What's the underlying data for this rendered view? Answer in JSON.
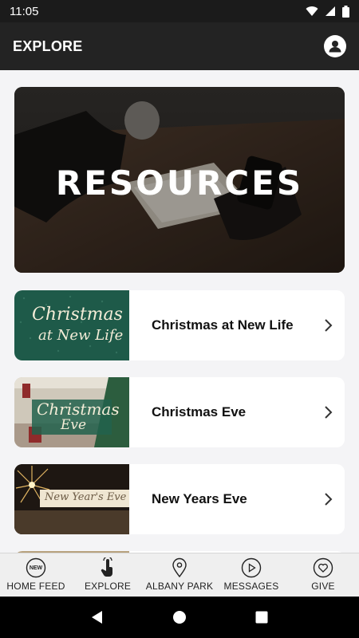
{
  "status_bar": {
    "time": "11:05"
  },
  "app_bar": {
    "title": "EXPLORE"
  },
  "hero": {
    "label": "RESOURCES"
  },
  "resources": [
    {
      "title": "Christmas at New Life",
      "thumb_line1": "Christmas",
      "thumb_line2": "at New Life"
    },
    {
      "title": "Christmas Eve",
      "thumb_line1": "Christmas",
      "thumb_line2": "Eve"
    },
    {
      "title": "New Years Eve",
      "thumb_line1": "New Year's Eve"
    }
  ],
  "bottom_nav": [
    {
      "label": "HOME FEED",
      "icon": "new-badge-icon",
      "badge": "NEW"
    },
    {
      "label": "EXPLORE",
      "icon": "touch-icon"
    },
    {
      "label": "ALBANY PARK",
      "icon": "map-pin-icon"
    },
    {
      "label": "MESSAGES",
      "icon": "play-circle-icon"
    },
    {
      "label": "GIVE",
      "icon": "heart-circle-icon"
    }
  ],
  "colors": {
    "app_bar": "#232323",
    "background": "#f4f4f6",
    "thumb_green": "#1e5a49"
  }
}
